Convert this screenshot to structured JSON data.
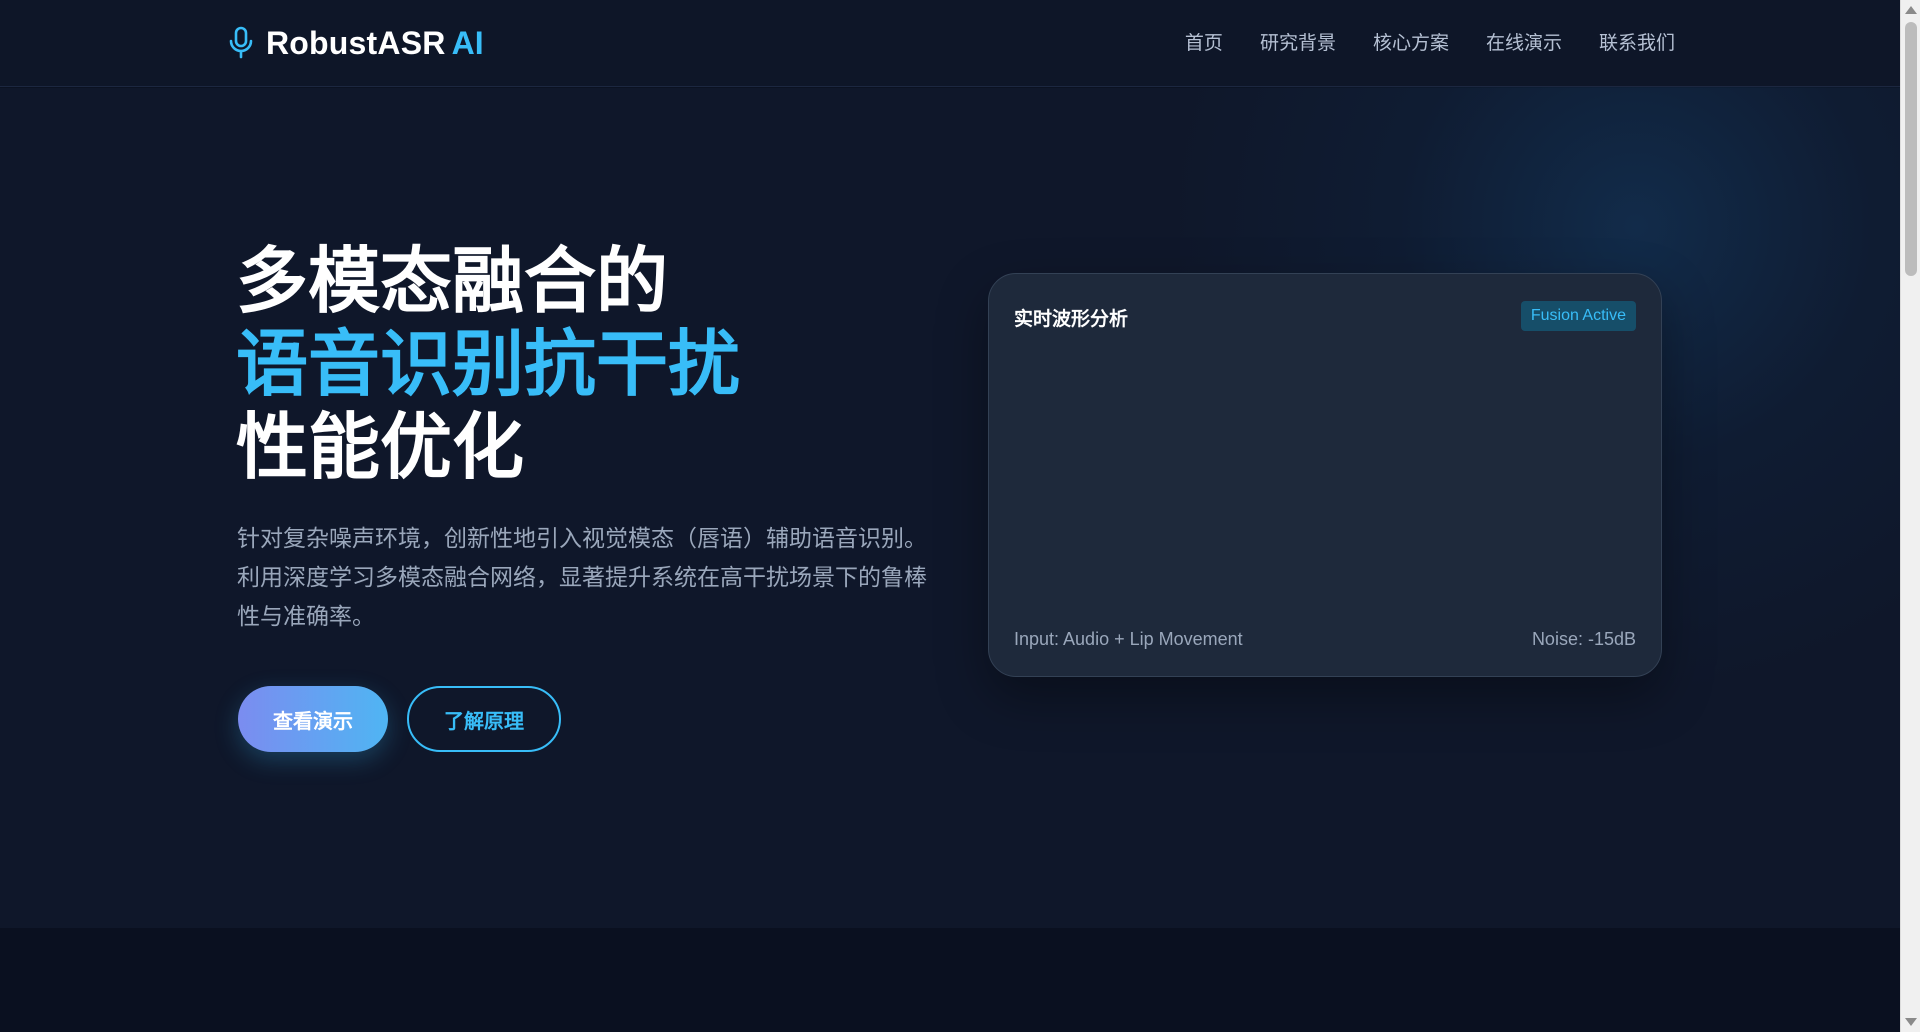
{
  "brand": {
    "name": "RobustASR",
    "accent": "AI",
    "icon": "microphone-icon"
  },
  "nav": {
    "items": [
      {
        "label": "首页"
      },
      {
        "label": "研究背景"
      },
      {
        "label": "核心方案"
      },
      {
        "label": "在线演示"
      },
      {
        "label": "联系我们"
      }
    ]
  },
  "hero": {
    "title_line1": "多模态融合的",
    "title_line2": "语音识别抗干扰",
    "title_line3": "性能优化",
    "description": "针对复杂噪声环境，创新性地引入视觉模态（唇语）辅助语音识别。利用深度学习多模态融合网络，显著提升系统在高干扰场景下的鲁棒性与准确率。",
    "primary_button": "查看演示",
    "secondary_button": "了解原理"
  },
  "card": {
    "title": "实时波形分析",
    "badge": "Fusion Active",
    "input_label": "Input: Audio + Lip Movement",
    "noise_label": "Noise: -15dB"
  },
  "colors": {
    "accent": "#38bdf8",
    "background": "#0f172a",
    "card": "#1e293b",
    "gradient_start": "#7b8cf0",
    "gradient_end": "#4fb5f3"
  }
}
